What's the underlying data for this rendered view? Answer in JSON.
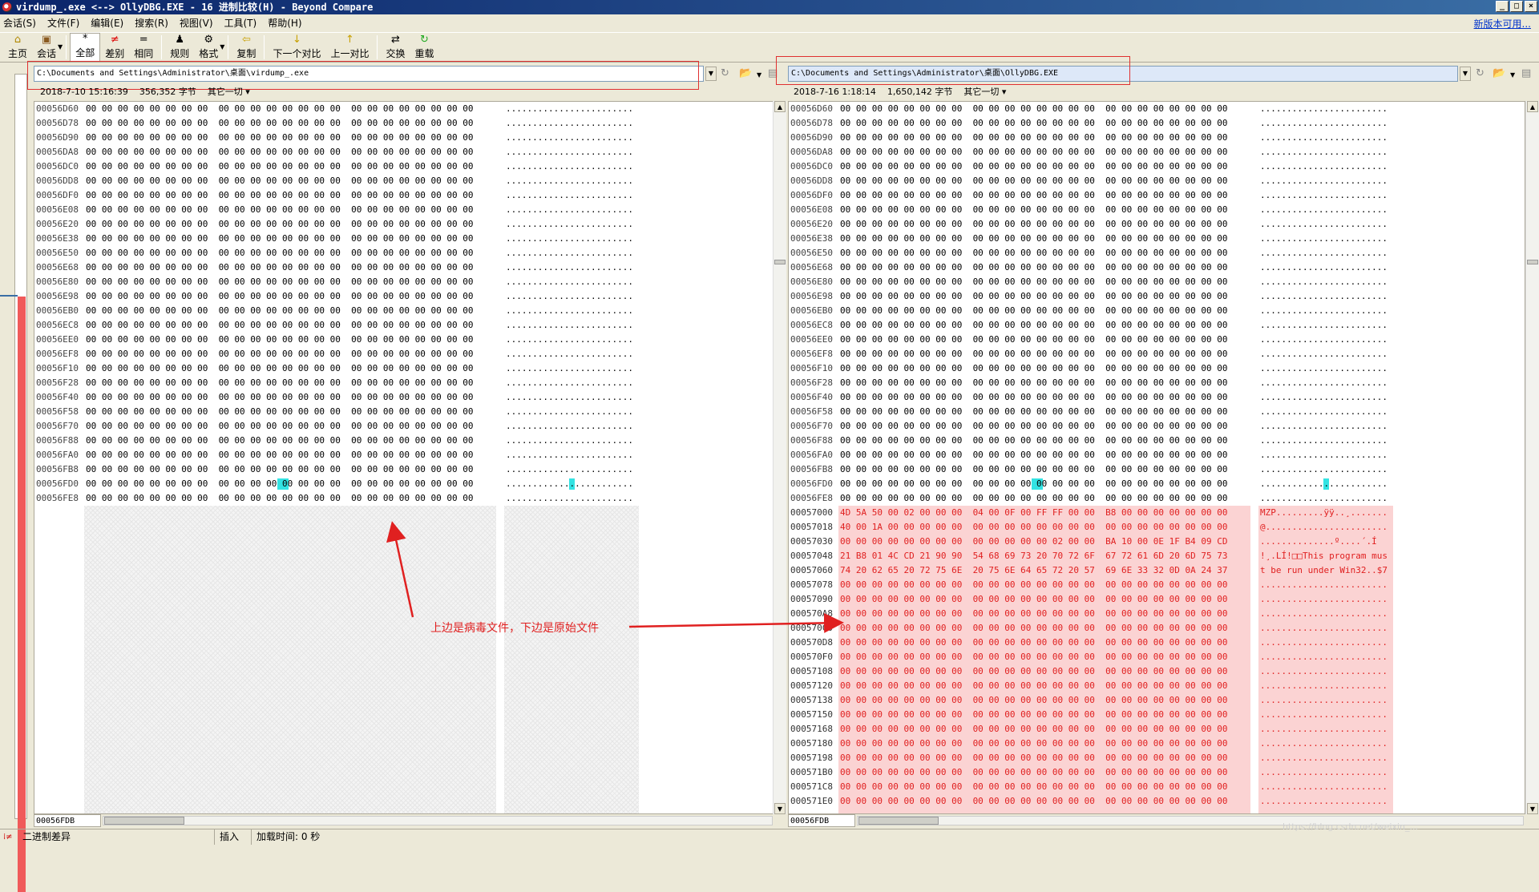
{
  "window": {
    "title": "virdump_.exe <--> OllyDBG.EXE - 16 进制比较(H) - Beyond Compare",
    "minimize": "_",
    "maximize": "□",
    "close": "×"
  },
  "menu": [
    "会话(S)",
    "文件(F)",
    "编辑(E)",
    "搜索(R)",
    "视图(V)",
    "工具(T)",
    "帮助(H)"
  ],
  "update_link": "新版本可用...",
  "toolbar": [
    {
      "label": "主页",
      "icon": "home-icon",
      "glyph": "⌂"
    },
    {
      "label": "会话",
      "icon": "briefcase-icon",
      "glyph": "▣",
      "caret": true
    },
    {
      "label": "全部",
      "icon": "asterisk-icon",
      "glyph": "*",
      "active": true
    },
    {
      "label": "差别",
      "icon": "not-equal-icon",
      "glyph": "≠"
    },
    {
      "label": "相同",
      "icon": "equal-icon",
      "glyph": "="
    },
    {
      "label": "规则",
      "icon": "referee-icon",
      "glyph": "♟"
    },
    {
      "label": "格式",
      "icon": "gear-icon",
      "glyph": "⚙",
      "caret": true
    },
    {
      "label": "复制",
      "icon": "copy-left-arrow-icon",
      "glyph": "⇦"
    },
    {
      "label": "下一个对比",
      "icon": "next-diff-icon",
      "glyph": "↓"
    },
    {
      "label": "上一对比",
      "icon": "prev-diff-icon",
      "glyph": "↑"
    },
    {
      "label": "交换",
      "icon": "swap-icon",
      "glyph": "⇄"
    },
    {
      "label": "重载",
      "icon": "reload-icon",
      "glyph": "↻"
    }
  ],
  "left": {
    "path": "C:\\Documents and Settings\\Administrator\\桌面\\virdump_.exe",
    "date": "2018-7-10 15:16:39",
    "size": "356,352 字节",
    "filter": "其它一切",
    "bottom_offset": "00056FDB"
  },
  "right": {
    "path": "C:\\Documents and Settings\\Administrator\\桌面\\OllyDBG.EXE",
    "date": "2018-7-16 1:18:14",
    "size": "1,650,142 字节",
    "filter": "其它一切",
    "bottom_offset": "00056FDB"
  },
  "zero_hex": "00 00 00 00 00 00 00 00  00 00 00 00 00 00 00 00  00 00 00 00 00 00 00 00",
  "zero_ascii": "........................",
  "common_offsets": [
    "00056D60",
    "00056D78",
    "00056D90",
    "00056DA8",
    "00056DC0",
    "00056DD8",
    "00056DF0",
    "00056E08",
    "00056E20",
    "00056E38",
    "00056E50",
    "00056E68",
    "00056E80",
    "00056E98",
    "00056EB0",
    "00056EC8",
    "00056EE0",
    "00056EF8",
    "00056F10",
    "00056F28",
    "00056F40",
    "00056F58",
    "00056F70",
    "00056F88",
    "00056FA0",
    "00056FB8",
    "00056FD0",
    "00056FE8"
  ],
  "right_extra_rows": [
    {
      "offset": "00057000",
      "hex": "4D 5A 50 00 02 00 00 00  04 00 0F 00 FF FF 00 00  B8 00 00 00 00 00 00 00",
      "ascii": "MZP.........ÿÿ..¸......."
    },
    {
      "offset": "00057018",
      "hex": "40 00 1A 00 00 00 00 00  00 00 00 00 00 00 00 00  00 00 00 00 00 00 00 00",
      "ascii": "@......................."
    },
    {
      "offset": "00057030",
      "hex": "00 00 00 00 00 00 00 00  00 00 00 00 00 02 00 00  BA 10 00 0E 1F B4 09 CD",
      "ascii": "..............º....´.Í"
    },
    {
      "offset": "00057048",
      "hex": "21 B8 01 4C CD 21 90 90  54 68 69 73 20 70 72 6F  67 72 61 6D 20 6D 75 73",
      "ascii": "!¸.LÍ!□□This program mus"
    },
    {
      "offset": "00057060",
      "hex": "74 20 62 65 20 72 75 6E  20 75 6E 64 65 72 20 57  69 6E 33 32 0D 0A 24 37",
      "ascii": "t be run under Win32..$7"
    },
    {
      "offset": "00057078",
      "hex": "00 00 00 00 00 00 00 00  00 00 00 00 00 00 00 00  00 00 00 00 00 00 00 00",
      "ascii": "........................"
    },
    {
      "offset": "00057090",
      "hex": "00 00 00 00 00 00 00 00  00 00 00 00 00 00 00 00  00 00 00 00 00 00 00 00",
      "ascii": "........................"
    },
    {
      "offset": "000570A8",
      "hex": "00 00 00 00 00 00 00 00  00 00 00 00 00 00 00 00  00 00 00 00 00 00 00 00",
      "ascii": "........................"
    },
    {
      "offset": "000570C0",
      "hex": "00 00 00 00 00 00 00 00  00 00 00 00 00 00 00 00  00 00 00 00 00 00 00 00",
      "ascii": "........................"
    },
    {
      "offset": "000570D8",
      "hex": "00 00 00 00 00 00 00 00  00 00 00 00 00 00 00 00  00 00 00 00 00 00 00 00",
      "ascii": "........................"
    },
    {
      "offset": "000570F0",
      "hex": "00 00 00 00 00 00 00 00  00 00 00 00 00 00 00 00  00 00 00 00 00 00 00 00",
      "ascii": "........................"
    },
    {
      "offset": "00057108",
      "hex": "00 00 00 00 00 00 00 00  00 00 00 00 00 00 00 00  00 00 00 00 00 00 00 00",
      "ascii": "........................"
    },
    {
      "offset": "00057120",
      "hex": "00 00 00 00 00 00 00 00  00 00 00 00 00 00 00 00  00 00 00 00 00 00 00 00",
      "ascii": "........................"
    },
    {
      "offset": "00057138",
      "hex": "00 00 00 00 00 00 00 00  00 00 00 00 00 00 00 00  00 00 00 00 00 00 00 00",
      "ascii": "........................"
    },
    {
      "offset": "00057150",
      "hex": "00 00 00 00 00 00 00 00  00 00 00 00 00 00 00 00  00 00 00 00 00 00 00 00",
      "ascii": "........................"
    },
    {
      "offset": "00057168",
      "hex": "00 00 00 00 00 00 00 00  00 00 00 00 00 00 00 00  00 00 00 00 00 00 00 00",
      "ascii": "........................"
    },
    {
      "offset": "00057180",
      "hex": "00 00 00 00 00 00 00 00  00 00 00 00 00 00 00 00  00 00 00 00 00 00 00 00",
      "ascii": "........................"
    },
    {
      "offset": "00057198",
      "hex": "00 00 00 00 00 00 00 00  00 00 00 00 00 00 00 00  00 00 00 00 00 00 00 00",
      "ascii": "........................"
    },
    {
      "offset": "000571B0",
      "hex": "00 00 00 00 00 00 00 00  00 00 00 00 00 00 00 00  00 00 00 00 00 00 00 00",
      "ascii": "........................"
    },
    {
      "offset": "000571C8",
      "hex": "00 00 00 00 00 00 00 00  00 00 00 00 00 00 00 00  00 00 00 00 00 00 00 00",
      "ascii": "........................"
    },
    {
      "offset": "000571E0",
      "hex": "00 00 00 00 00 00 00 00  00 00 00 00 00 00 00 00  00 00 00 00 00 00 00 00",
      "ascii": "........................"
    }
  ],
  "annotation": "上边是病毒文件，下边是原始文件",
  "status": {
    "mode": "二进制差异",
    "insert": "插入",
    "load_time": "加载时间: 0 秒"
  },
  "watermark": "https://blog.csdn.net/weixin_..."
}
